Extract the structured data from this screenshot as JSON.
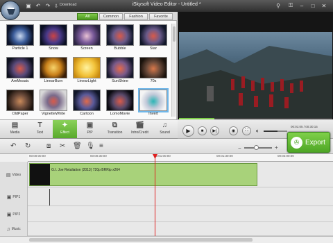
{
  "app": {
    "title": "iSkysoft Video Editor - Untitled *",
    "download_label": "Download"
  },
  "filter_tabs": [
    {
      "label": "All"
    },
    {
      "label": "Common"
    },
    {
      "label": "Fashion"
    },
    {
      "label": "Favorite"
    }
  ],
  "effects": [
    {
      "label": "Particle 1"
    },
    {
      "label": "Snow"
    },
    {
      "label": "Screen"
    },
    {
      "label": "Bubble"
    },
    {
      "label": "Star"
    },
    {
      "label": "AmMosaic"
    },
    {
      "label": "LinearBurn"
    },
    {
      "label": "LinearLight"
    },
    {
      "label": "SunShine"
    },
    {
      "label": "70s"
    },
    {
      "label": "OldPaper"
    },
    {
      "label": "VignetteWhite"
    },
    {
      "label": "Cartoon"
    },
    {
      "label": "LomoMovie"
    },
    {
      "label": "Invert"
    }
  ],
  "toolbar": [
    {
      "label": "Media",
      "icon": "film-icon"
    },
    {
      "label": "Text",
      "icon": "text-icon"
    },
    {
      "label": "Effect",
      "icon": "effect-icon"
    },
    {
      "label": "PIP",
      "icon": "pip-icon"
    },
    {
      "label": "Transition",
      "icon": "transition-icon"
    },
    {
      "label": "Intro/Credit",
      "icon": "clapper-icon"
    },
    {
      "label": "Sound",
      "icon": "headphones-icon"
    }
  ],
  "player": {
    "time": "00:01:05 / 00:30:15",
    "progress": 0.23,
    "volume": 0.6
  },
  "export": {
    "label": "Export"
  },
  "ruler": [
    "00:00:00:00",
    "00:00:30:00",
    "00:01:00:00",
    "00:01:30:00",
    "00:02:00:00"
  ],
  "tracks": [
    {
      "label": "Video"
    },
    {
      "label": "PIP1"
    },
    {
      "label": "PIP2"
    },
    {
      "label": "Music"
    }
  ],
  "clip": {
    "label": "G.I. Joe Retaliation (2013) 720p BRRip x264"
  },
  "colors": {
    "accent": "#5aa82c",
    "playhead": "#e02020",
    "clip": "#a8d27a"
  }
}
